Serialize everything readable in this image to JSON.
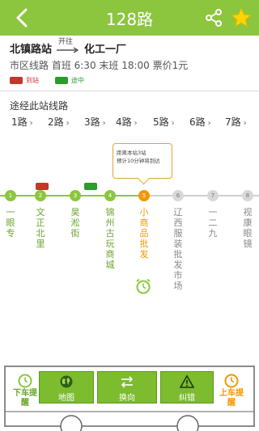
{
  "header": {
    "title": "128路",
    "colors": {
      "bar": "#8cc63f",
      "star": "#ffd400"
    }
  },
  "route": {
    "from": "北镇路站",
    "direction_label": "开往",
    "to": "化工一厂",
    "detail": "市区线路  首班 6:30  末班 18:00  票价1元",
    "legend": {
      "arrived": "到站",
      "enroute": "途中"
    }
  },
  "transfer": {
    "title": "途经此站线路",
    "lines": [
      "1路",
      "2路",
      "3路",
      "4路",
      "5路",
      "6路",
      "7路"
    ]
  },
  "tooltip": {
    "line1": "距离本站3站",
    "line2": "预计10分钟将到达"
  },
  "stops": [
    {
      "num": "1",
      "name": "一眼专",
      "state": "passed"
    },
    {
      "num": "2",
      "name": "文正北里",
      "state": "passed"
    },
    {
      "num": "3",
      "name": "昊淞街",
      "state": "passed"
    },
    {
      "num": "4",
      "name": "锦州古玩商城",
      "state": "passed"
    },
    {
      "num": "5",
      "name": "小商品批发",
      "state": "current"
    },
    {
      "num": "6",
      "name": "辽西服装批发市场",
      "state": "future"
    },
    {
      "num": "7",
      "name": "一二九",
      "state": "future"
    },
    {
      "num": "8",
      "name": "视康眼镜",
      "state": "future"
    }
  ],
  "bottom": {
    "get_off": "下车提醒",
    "map": "地图",
    "reverse": "换向",
    "report": "纠错",
    "get_on": "上车提醒"
  }
}
